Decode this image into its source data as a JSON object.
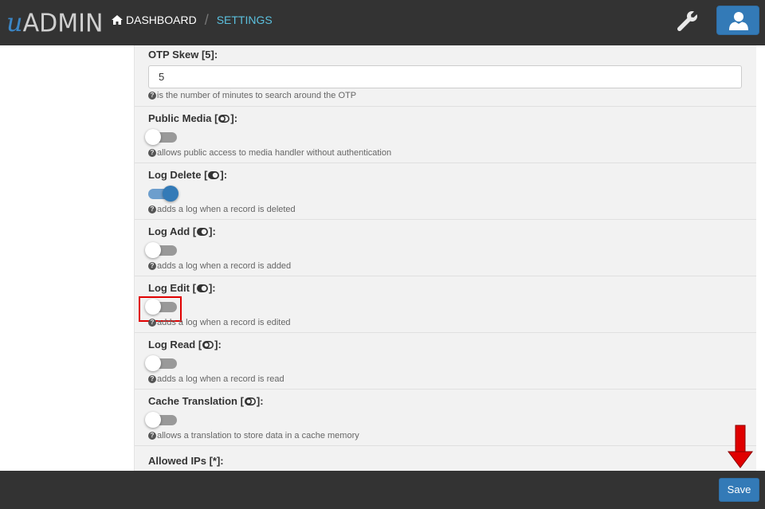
{
  "app": {
    "logo_prefix": "u",
    "logo_text": "ADMIN"
  },
  "breadcrumb": {
    "home": "DASHBOARD",
    "current": "SETTINGS"
  },
  "settings": {
    "otp_skew": {
      "label": "OTP Skew [5]:",
      "value": "5",
      "help": "is the number of minutes to search around the OTP"
    },
    "public_media": {
      "label_prefix": "Public Media [",
      "label_suffix": "]:",
      "enabled": false,
      "help": "allows public access to media handler without authentication"
    },
    "log_delete": {
      "label_prefix": "Log Delete [",
      "label_suffix": "]:",
      "enabled": true,
      "help": "adds a log when a record is deleted"
    },
    "log_add": {
      "label_prefix": "Log Add [",
      "label_suffix": "]:",
      "enabled": false,
      "help": "adds a log when a record is added"
    },
    "log_edit": {
      "label_prefix": "Log Edit [",
      "label_suffix": "]:",
      "enabled": false,
      "help": "adds a log when a record is edited"
    },
    "log_read": {
      "label_prefix": "Log Read [",
      "label_suffix": "]:",
      "enabled": false,
      "help": "adds a log when a record is read"
    },
    "cache_translation": {
      "label_prefix": "Cache Translation [",
      "label_suffix": "]:",
      "enabled": false,
      "help": "allows a translation to store data in a cache memory"
    },
    "allowed_ips": {
      "label": "Allowed IPs [*]:"
    }
  },
  "footer": {
    "save_label": "Save"
  },
  "icons": {
    "home": "home-icon",
    "wrench": "wrench-icon",
    "user": "user-icon",
    "help": "question-circle-icon",
    "toggle_on": "toggle-on-icon",
    "toggle_off": "toggle-off-icon",
    "arrow": "arrow-down-icon"
  },
  "colors": {
    "navbar": "#333333",
    "accent": "#337ab7",
    "breadcrumb_active": "#5bc0de",
    "highlight": "#e00000",
    "arrow": "#e00000"
  }
}
